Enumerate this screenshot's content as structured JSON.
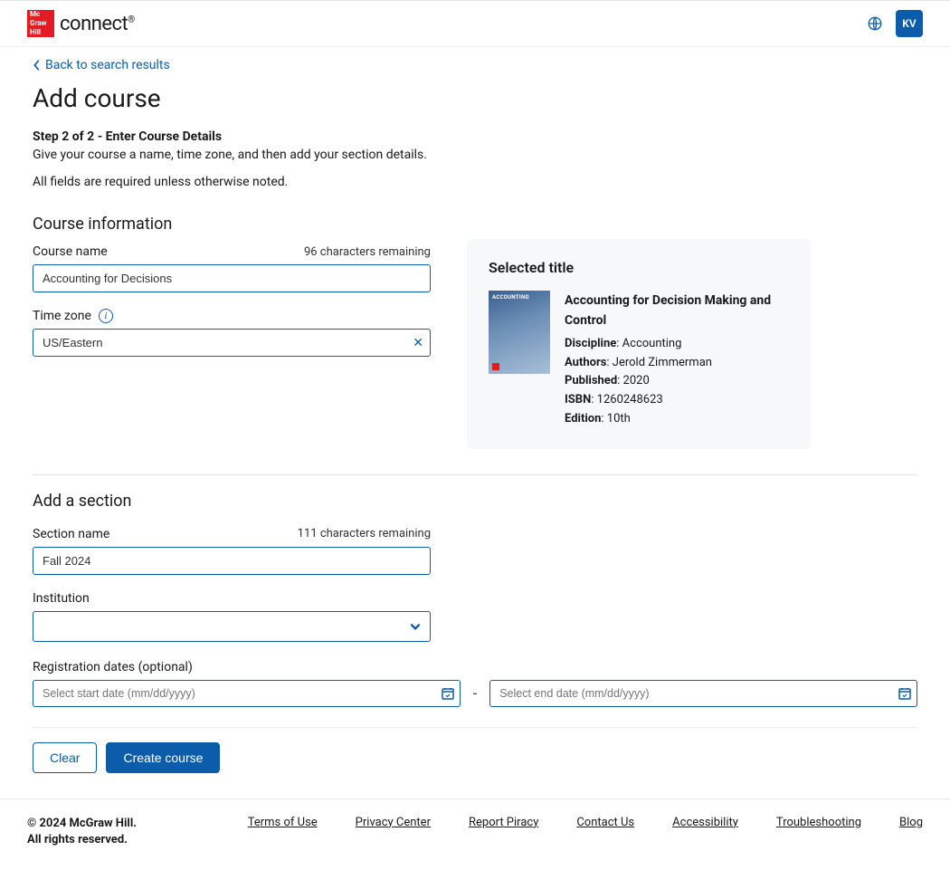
{
  "header": {
    "logo_lines": [
      "Mc",
      "Graw",
      "Hill"
    ],
    "brand_prefix": "connect",
    "reg_mark": "®",
    "user_initials": "KV"
  },
  "nav": {
    "back_label": "Back to search results"
  },
  "page": {
    "title": "Add course",
    "step_line": "Step 2 of 2 - Enter Course Details",
    "instruction": "Give your course a name, time zone, and then add your section details.",
    "required_note": "All fields are required unless otherwise noted."
  },
  "course_info": {
    "heading": "Course information",
    "course_name_label": "Course name",
    "course_name_remaining": "96 characters remaining",
    "course_name_value": "Accounting for Decisions",
    "timezone_label": "Time zone",
    "timezone_value": "US/Eastern"
  },
  "selected_title": {
    "heading": "Selected title",
    "book_cover_text": "ACCOUNTING",
    "book_title": "Accounting for Decision Making and Control",
    "discipline_label": "Discipline",
    "discipline_value": "Accounting",
    "authors_label": "Authors",
    "authors_value": "Jerold Zimmerman",
    "published_label": "Published",
    "published_value": "2020",
    "isbn_label": "ISBN",
    "isbn_value": "1260248623",
    "edition_label": "Edition",
    "edition_value": "10th"
  },
  "section": {
    "heading": "Add a section",
    "section_name_label": "Section name",
    "section_name_remaining": "111 characters remaining",
    "section_name_value": "Fall 2024",
    "institution_label": "Institution",
    "institution_value": "",
    "reg_dates_label": "Registration dates (optional)",
    "start_placeholder": "Select start date (mm/dd/yyyy)",
    "end_placeholder": "Select end date (mm/dd/yyyy)",
    "dash": "-"
  },
  "buttons": {
    "clear": "Clear",
    "create": "Create course"
  },
  "footer": {
    "copyright_line1": "© 2024 McGraw Hill.",
    "copyright_line2": "All rights reserved.",
    "links": {
      "terms": "Terms of Use",
      "privacy": "Privacy Center",
      "piracy": "Report Piracy",
      "contact": "Contact Us",
      "accessibility": "Accessibility",
      "troubleshooting": "Troubleshooting",
      "blog": "Blog"
    }
  }
}
